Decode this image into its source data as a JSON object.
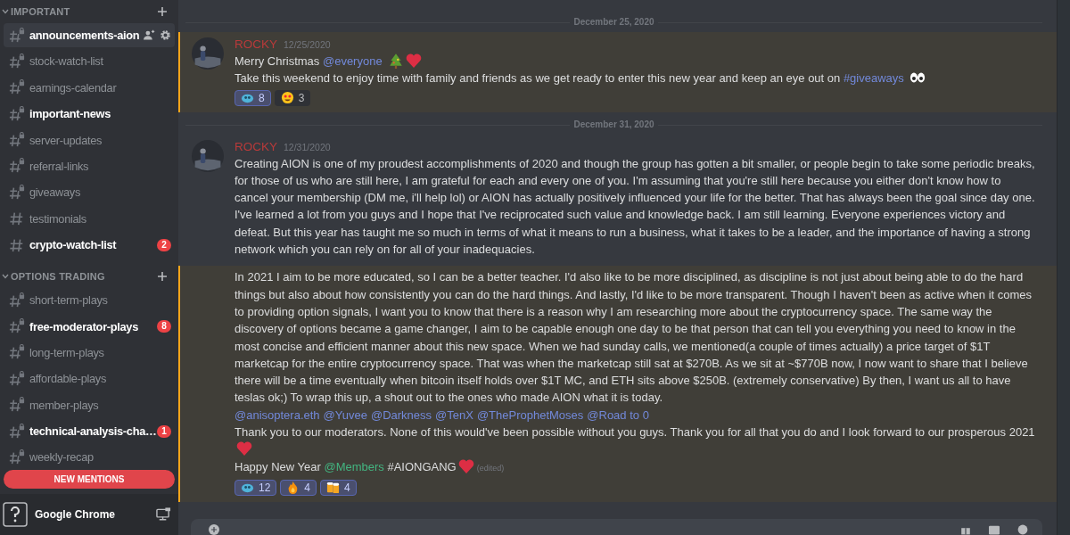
{
  "sidebar": {
    "categories": [
      {
        "name": "IMPORTANT",
        "channels": [
          {
            "name": "announcements-aion",
            "locked": true,
            "unread": true,
            "selected": true
          },
          {
            "name": "stock-watch-list",
            "locked": true,
            "unread": false,
            "selected": false
          },
          {
            "name": "earnings-calendar",
            "locked": true,
            "unread": false,
            "selected": false
          },
          {
            "name": "important-news",
            "locked": true,
            "unread": true,
            "selected": false
          },
          {
            "name": "server-updates",
            "locked": true,
            "unread": false,
            "selected": false
          },
          {
            "name": "referral-links",
            "locked": true,
            "unread": false,
            "selected": false
          },
          {
            "name": "giveaways",
            "locked": true,
            "unread": false,
            "selected": false
          },
          {
            "name": "testimonials",
            "locked": false,
            "unread": false,
            "selected": false
          },
          {
            "name": "crypto-watch-list",
            "locked": false,
            "unread": true,
            "selected": false,
            "badge": "2"
          }
        ]
      },
      {
        "name": "OPTIONS TRADING",
        "channels": [
          {
            "name": "short-term-plays",
            "locked": true,
            "unread": false,
            "selected": false
          },
          {
            "name": "free-moderator-plays",
            "locked": true,
            "unread": true,
            "selected": false,
            "badge": "8"
          },
          {
            "name": "long-term-plays",
            "locked": true,
            "unread": false,
            "selected": false
          },
          {
            "name": "affordable-plays",
            "locked": true,
            "unread": false,
            "selected": false
          },
          {
            "name": "member-plays",
            "locked": true,
            "unread": false,
            "selected": false
          },
          {
            "name": "technical-analysis-cha…",
            "locked": true,
            "unread": true,
            "selected": false,
            "badge": "1"
          },
          {
            "name": "weekly-recap",
            "locked": true,
            "unread": false,
            "selected": false
          }
        ]
      }
    ],
    "new_mentions": "NEW MENTIONS",
    "activity": {
      "name": "Google Chrome"
    }
  },
  "feed": [
    {
      "kind": "divider",
      "text": "December 25, 2020"
    },
    {
      "kind": "message",
      "mentioned": true,
      "author": "ROCKY",
      "timestamp": "12/25/2020",
      "lines": [
        [
          {
            "kind": "text",
            "text": "Merry Christmas "
          },
          {
            "kind": "mention",
            "text": "@everyone"
          },
          {
            "kind": "tree"
          },
          {
            "kind": "heart"
          }
        ],
        [
          {
            "kind": "text",
            "text": "Take this weekend to enjoy time with family and friends as we get ready to enter this new year and keep an eye out on "
          },
          {
            "kind": "mention",
            "text": "#giveaways"
          },
          {
            "kind": "eyes"
          }
        ]
      ],
      "reactions": [
        {
          "kind": "blob",
          "count": "8",
          "selected": true
        },
        {
          "kind": "hearteyes",
          "count": "3",
          "selected": false
        }
      ]
    },
    {
      "kind": "divider",
      "text": "December 31, 2020"
    },
    {
      "kind": "message",
      "mentioned": false,
      "author": "ROCKY",
      "timestamp": "12/31/2020",
      "lines": [
        [
          {
            "kind": "text",
            "text": "Creating AION is one of my proudest accomplishments of 2020 and though the group has gotten a bit smaller, or people begin to take some periodic breaks, for those of us who are still here, I am grateful for each and every one of you. I'm assuming that you're still here because you either don't know how to cancel your membership (DM me, i'll help lol) or AION has actually positively influenced your life for the better. That has always been the goal since day one."
          }
        ],
        [
          {
            "kind": "text",
            "text": "I've learned a lot from you guys and I hope that I've reciprocated such value and knowledge back. I am still learning. Everyone experiences victory and defeat. But this year has taught me so much in terms of what it means to run a business, what it takes to be a leader, and the importance of having a strong network which you can rely on for all of your inadequacies."
          }
        ]
      ]
    },
    {
      "kind": "continuation",
      "mentioned": true,
      "lines": [
        [
          {
            "kind": "text",
            "text": "In 2021 I aim to be more educated, so I can be a better teacher. I'd also like to be more disciplined, as discipline is not just about being able to do the hard things but also about how consistently you can do the hard things. And lastly, I'd like to be more transparent. Though I haven't been as active when it comes to providing option signals, I want you to know that there is a reason why I am researching more about the cryptocurrency space. The same way the discovery of options became a game changer, I aim to be capable enough one day to be that person that can tell you everything you need to know in the most concise and efficient manner about this new space. When we had sunday calls, we mentioned(a couple of times actually) a price target of $1T marketcap for the entire cryptocurrency space. That was when the marketcap still sat at $270B. As we sit at ~$770B now, I now want to share that I believe there will be a time eventually when bitcoin itself holds over $1T MC, and ETH sits above $250B. (extremely conservative) By then, I want us all to have teslas ok;) To wrap this up, a shout out to the ones who made AION what it is today. "
          },
          {
            "kind": "mention",
            "text": "@anisoptera.eth"
          },
          {
            "kind": "mention",
            "text": "@Yuvee"
          },
          {
            "kind": "mention",
            "text": "@Darkness"
          },
          {
            "kind": "mention",
            "text": "@TenX"
          },
          {
            "kind": "mention",
            "text": "@TheProphetMoses"
          },
          {
            "kind": "mention",
            "text": "@Road to 0"
          }
        ],
        [
          {
            "kind": "text",
            "text": "Thank you to our moderators. None of this would've been possible without you guys. Thank you for all that you do and I look forward to our prosperous 2021"
          },
          {
            "kind": "heart"
          }
        ],
        [
          {
            "kind": "text",
            "text": "Happy New Year "
          },
          {
            "kind": "role",
            "text": "@Members"
          },
          {
            "kind": "text",
            "text": "  #AIONGANG"
          },
          {
            "kind": "heart"
          },
          {
            "kind": "edited",
            "text": "(edited)"
          }
        ]
      ],
      "reactions": [
        {
          "kind": "blob",
          "count": "12",
          "selected": true
        },
        {
          "kind": "fire",
          "count": "4",
          "selected": true
        },
        {
          "kind": "beer",
          "count": "4",
          "selected": true
        }
      ]
    }
  ]
}
